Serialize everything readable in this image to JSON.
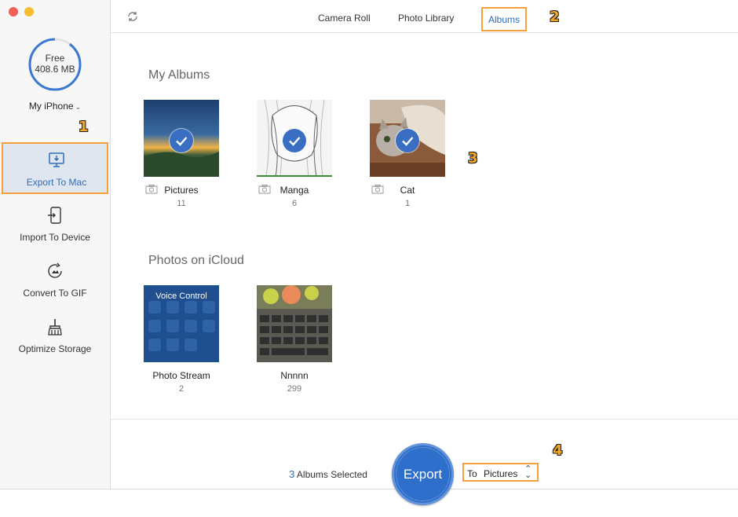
{
  "sidebar": {
    "storage": {
      "label": "Free",
      "value": "408.6 MB",
      "used_fraction": 0.1
    },
    "device": {
      "name": "My iPhone"
    },
    "items": [
      {
        "label": "Export To Mac",
        "icon": "export-to-mac-icon",
        "active": true
      },
      {
        "label": "Import To Device",
        "icon": "import-to-device-icon"
      },
      {
        "label": "Convert To GIF",
        "icon": "convert-to-gif-icon"
      },
      {
        "label": "Optimize Storage",
        "icon": "broom-icon"
      }
    ]
  },
  "topbar": {
    "tabs": [
      {
        "label": "Camera Roll"
      },
      {
        "label": "Photo Library"
      },
      {
        "label": "Albums",
        "active": true
      }
    ]
  },
  "sections": {
    "my_albums": {
      "title": "My Albums",
      "albums": [
        {
          "name": "Pictures",
          "count": "11",
          "selected": true
        },
        {
          "name": "Manga",
          "count": "6",
          "selected": true
        },
        {
          "name": "Cat",
          "count": "1",
          "selected": true
        }
      ]
    },
    "icloud": {
      "title": "Photos on iCloud",
      "albums": [
        {
          "name": "Photo Stream",
          "count": "2",
          "overlay_text": "Voice Control"
        },
        {
          "name": "Nnnnn",
          "count": "299"
        }
      ]
    }
  },
  "footer": {
    "selected_count": "3",
    "selected_label": "Albums Selected",
    "export_label": "Export",
    "dest_prefix": "To",
    "dest_value": "Pictures"
  },
  "step_badges": [
    "1",
    "2",
    "3",
    "4"
  ],
  "colors": {
    "accent": "#2f6db7",
    "highlight": "#f5a03a",
    "check": "#3a6ec2"
  }
}
